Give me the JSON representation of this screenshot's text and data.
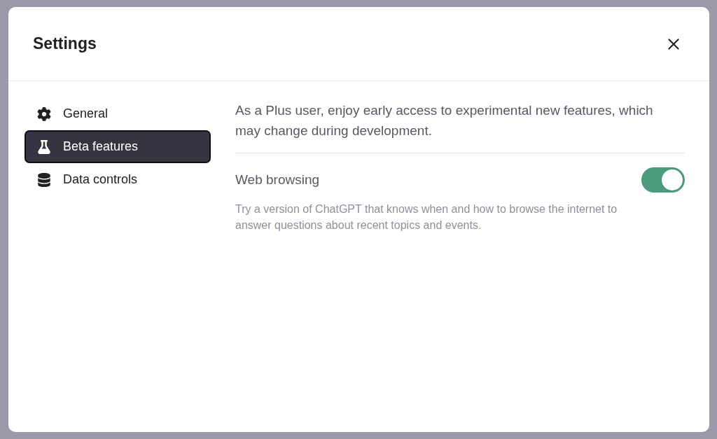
{
  "dialog": {
    "title": "Settings"
  },
  "sidebar": {
    "items": [
      {
        "label": "General",
        "selected": false
      },
      {
        "label": "Beta features",
        "selected": true
      },
      {
        "label": "Data controls",
        "selected": false
      }
    ]
  },
  "content": {
    "intro": "As a Plus user, enjoy early access to experimental new features, which may change during development.",
    "settings": [
      {
        "label": "Web browsing",
        "on": true,
        "description": "Try a version of ChatGPT that knows when and how to browse the internet to answer questions about recent topics and events."
      }
    ]
  }
}
